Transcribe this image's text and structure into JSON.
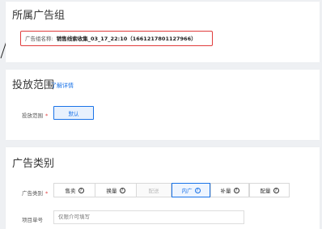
{
  "sections": {
    "ad_group": {
      "title": "所属广告组",
      "name_label": "广告组名称:",
      "name_value": "销售线索收集_03_17_22:10（1661217801127966）"
    },
    "scope": {
      "title": "投放范围",
      "learn_more": "了解详情",
      "label": "投放范围",
      "required_mark": "*",
      "option": "默认"
    },
    "category": {
      "title": "广告类别",
      "label": "广告类别",
      "required_mark": "*",
      "options": [
        {
          "label": "售卖",
          "state": "normal"
        },
        {
          "label": "换量",
          "state": "normal"
        },
        {
          "label": "配送",
          "state": "disabled"
        },
        {
          "label": "内广",
          "state": "selected"
        },
        {
          "label": "补量",
          "state": "normal"
        },
        {
          "label": "配量",
          "state": "normal"
        }
      ],
      "help_icon_glyph": "?",
      "item_label": "项目单号",
      "item_placeholder": "仅限介可填写"
    }
  },
  "colors": {
    "accent": "#1a73e8",
    "highlight_border": "#e03c3c",
    "background": "#eef0f3"
  }
}
